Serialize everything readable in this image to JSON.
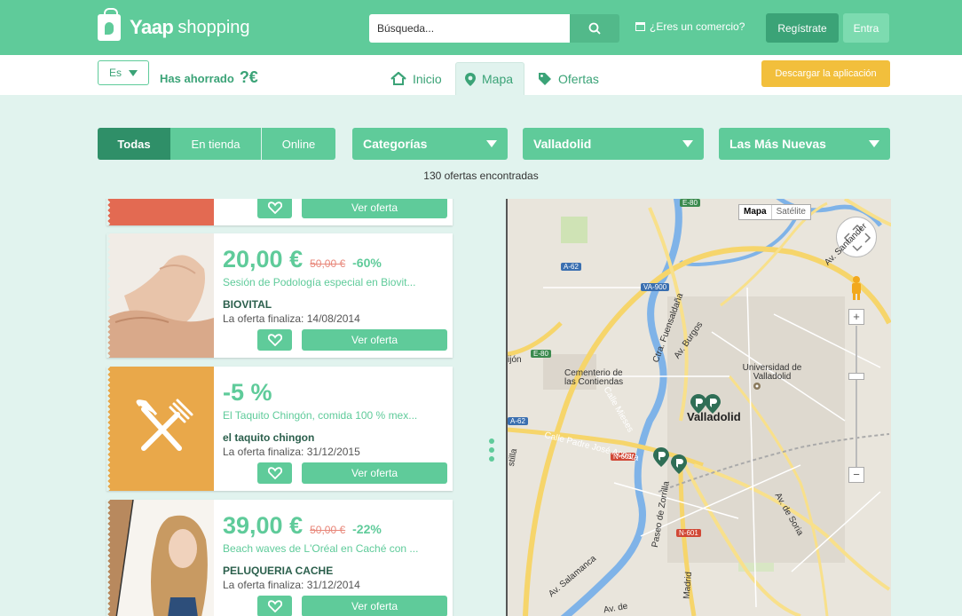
{
  "header": {
    "logo_mark": "Yaap",
    "logo_word": "shopping",
    "search_placeholder": "Búsqueda...",
    "commerce_link": "¿Eres un comercio?",
    "register_label": "Regístrate",
    "login_label": "Entra"
  },
  "subnav": {
    "language": "Es",
    "saved_label": "Has ahorrado",
    "saved_amount": "?€",
    "tabs": [
      {
        "label": "Inicio",
        "icon": "home-icon",
        "active": false
      },
      {
        "label": "Mapa",
        "icon": "pin-icon",
        "active": true
      },
      {
        "label": "Ofertas",
        "icon": "tag-icon",
        "active": false
      }
    ],
    "download_app": "Descargar la aplicación"
  },
  "filters": {
    "channel": [
      "Todas",
      "En tienda",
      "Online"
    ],
    "channel_selected": "Todas",
    "category": "Categorías",
    "city": "Valladolid",
    "sort": "Las Más Nuevas"
  },
  "results_count": "130 ofertas encontradas",
  "offers": [
    {
      "price": "",
      "old_price": "",
      "discount": "",
      "title": "",
      "shop": "",
      "ends": "",
      "cta": "Ver oferta",
      "thumb_color": "#e36a52",
      "partial": true
    },
    {
      "price": "20,00 €",
      "old_price": "50,00 €",
      "discount": "-60%",
      "title": "Sesión de Podología especial en Biovit...",
      "shop": "BIOVITAL",
      "ends": "La oferta finaliza: 14/08/2014",
      "cta": "Ver oferta",
      "thumb_color": "#f1ece6"
    },
    {
      "price": "-5 %",
      "old_price": "",
      "discount": "",
      "title": "El Taquito Chingón, comida 100 % mex...",
      "shop": "el taquito chingon",
      "ends": "La oferta finaliza: 31/12/2015",
      "cta": "Ver oferta",
      "thumb_color": "#e9a84a"
    },
    {
      "price": "39,00 €",
      "old_price": "50,00 €",
      "discount": "-22%",
      "title": "Beach waves de L'Oréal en Caché con ...",
      "shop": "PELUQUERIA CACHE",
      "ends": "La oferta finaliza: 31/12/2014",
      "cta": "Ver oferta",
      "thumb_color": "#f3efe9"
    }
  ],
  "map": {
    "type_map": "Mapa",
    "type_satellite": "Satélite",
    "city_label": "Valladolid",
    "labels": [
      "Cementerio de las Contiendas",
      "Universidad de Valladolid",
      "Calle Padre José Acosta",
      "Calle Mieses",
      "Paseo de Zorrilla",
      "Av. Salamanca",
      "Av. de Soria",
      "Ctra. Fuensaldaña",
      "Av. Burgos",
      "Av. Santander",
      "Madrid",
      "Av. de",
      "ijón",
      "stilla"
    ],
    "road_tags": [
      "E-80",
      "A-62",
      "VA-900",
      "E-80",
      "A-62",
      "N-601",
      "N-601"
    ],
    "colors": {
      "primary": "#5fcb9a",
      "dark": "#2f8f68",
      "accent": "#f2bf3c",
      "old_price": "#e8877a"
    }
  }
}
